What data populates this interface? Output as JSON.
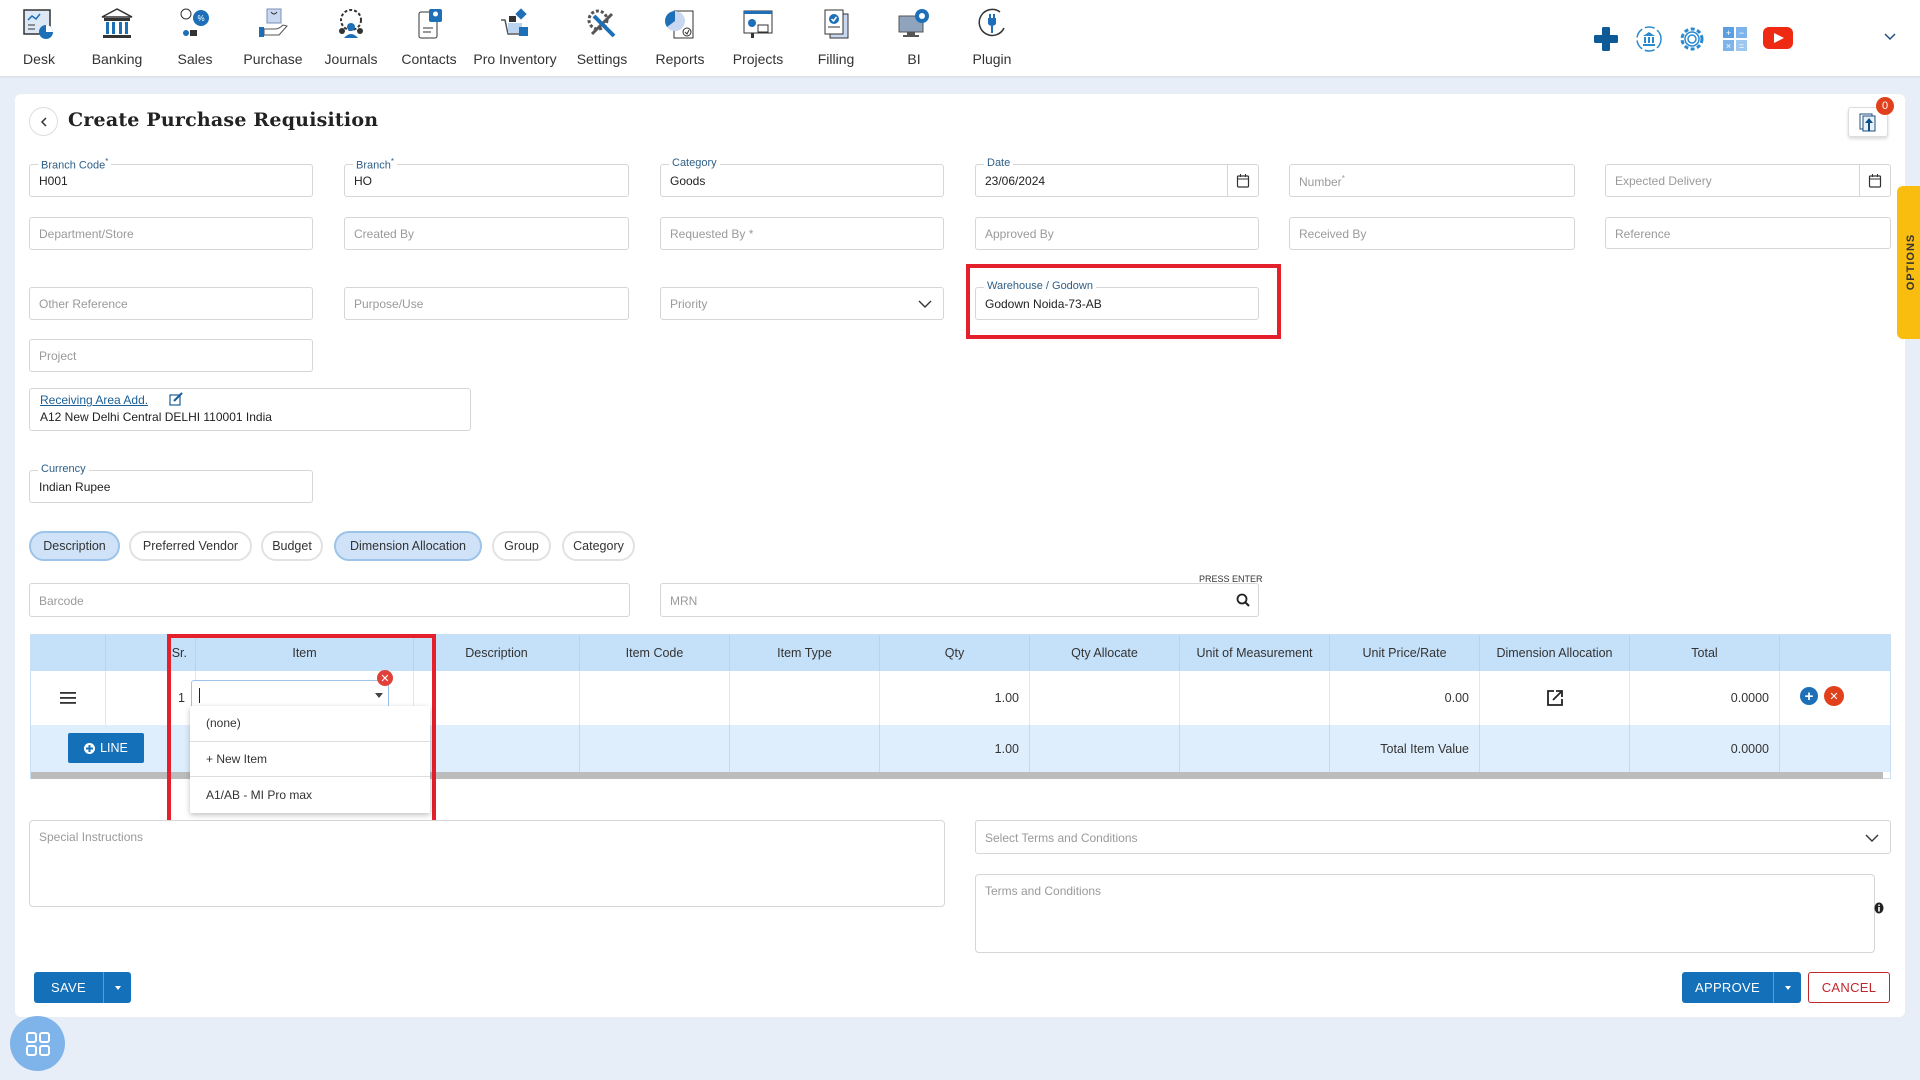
{
  "nav": {
    "items": [
      {
        "label": "Desk",
        "icon": "desk-icon"
      },
      {
        "label": "Banking",
        "icon": "bank-icon"
      },
      {
        "label": "Sales",
        "icon": "sales-icon"
      },
      {
        "label": "Purchase",
        "icon": "purchase-icon"
      },
      {
        "label": "Journals",
        "icon": "journals-icon"
      },
      {
        "label": "Contacts",
        "icon": "contacts-icon"
      },
      {
        "label": "Pro Inventory",
        "icon": "inventory-icon"
      },
      {
        "label": "Settings",
        "icon": "settings-tools-icon"
      },
      {
        "label": "Reports",
        "icon": "reports-icon"
      },
      {
        "label": "Projects",
        "icon": "projects-icon"
      },
      {
        "label": "Filling",
        "icon": "filing-icon"
      },
      {
        "label": "BI",
        "icon": "bi-icon"
      },
      {
        "label": "Plugin",
        "icon": "plugin-icon"
      }
    ],
    "right_icons": [
      "plus-icon",
      "bank-sync-icon",
      "gear-icon",
      "calculator-icon",
      "youtube-icon",
      "chevron-down-icon"
    ]
  },
  "page": {
    "title": "Create Purchase Requisition",
    "attachment_count": "0"
  },
  "form": {
    "branch_code": {
      "label": "Branch Code",
      "value": "H001"
    },
    "branch": {
      "label": "Branch",
      "value": "HO"
    },
    "category": {
      "label": "Category",
      "value": "Goods"
    },
    "date": {
      "label": "Date",
      "value": "23/06/2024"
    },
    "number": {
      "placeholder": "Number"
    },
    "expected_delivery": {
      "placeholder": "Expected Delivery"
    },
    "department": {
      "placeholder": "Department/Store"
    },
    "created_by": {
      "placeholder": "Created By"
    },
    "requested_by": {
      "placeholder": "Requested By *"
    },
    "approved_by": {
      "placeholder": "Approved By"
    },
    "received_by": {
      "placeholder": "Received By"
    },
    "reference": {
      "placeholder": "Reference"
    },
    "other_reference": {
      "placeholder": "Other Reference"
    },
    "purpose": {
      "placeholder": "Purpose/Use"
    },
    "priority": {
      "placeholder": "Priority"
    },
    "warehouse": {
      "label": "Warehouse / Godown",
      "value": "Godown Noida-73-AB"
    },
    "project": {
      "placeholder": "Project"
    },
    "receiving_area": {
      "link": "Receiving Area Add.",
      "address": "A12 New Delhi Central DELHI 110001 India"
    },
    "currency": {
      "label": "Currency",
      "value": "Indian Rupee"
    }
  },
  "pills": [
    {
      "label": "Description",
      "active": true
    },
    {
      "label": "Preferred Vendor",
      "active": false
    },
    {
      "label": "Budget",
      "active": false
    },
    {
      "label": "Dimension Allocation",
      "active": true
    },
    {
      "label": "Group",
      "active": false
    },
    {
      "label": "Category",
      "active": false
    }
  ],
  "search": {
    "barcode_placeholder": "Barcode",
    "mrn_placeholder": "MRN",
    "press_enter": "PRESS ENTER"
  },
  "table": {
    "columns": [
      "",
      "Sr.",
      "Item",
      "Description",
      "Item Code",
      "Item Type",
      "Qty",
      "Qty Allocate",
      "Unit of Measurement",
      "Unit Price/Rate",
      "Dimension Allocation",
      "Total",
      ""
    ],
    "rows": [
      {
        "sr": "1",
        "item": "",
        "description": "",
        "item_code": "",
        "item_type": "",
        "qty": "1.00",
        "qty_allocate": "",
        "uom": "",
        "unit_price": "0.00",
        "total": "0.0000"
      }
    ],
    "footer": {
      "line_button": "LINE",
      "qty_total": "1.00",
      "total_label": "Total Item Value",
      "total_value": "0.0000"
    },
    "item_dropdown": [
      "(none)",
      "+ New Item",
      "A1/AB - MI Pro max"
    ]
  },
  "bottom": {
    "special_instructions_placeholder": "Special Instructions",
    "terms_select_placeholder": "Select Terms and Conditions",
    "terms_placeholder": "Terms and Conditions"
  },
  "actions": {
    "save": "SAVE",
    "approve": "APPROVE",
    "cancel": "CANCEL"
  },
  "side_tab": {
    "label": "OPTIONS"
  },
  "colors": {
    "primary": "#1470b8",
    "highlight": "#e3202b",
    "options_tab": "#f9bd10",
    "table_header": "#c5e0f9",
    "danger": "#e0411c"
  }
}
